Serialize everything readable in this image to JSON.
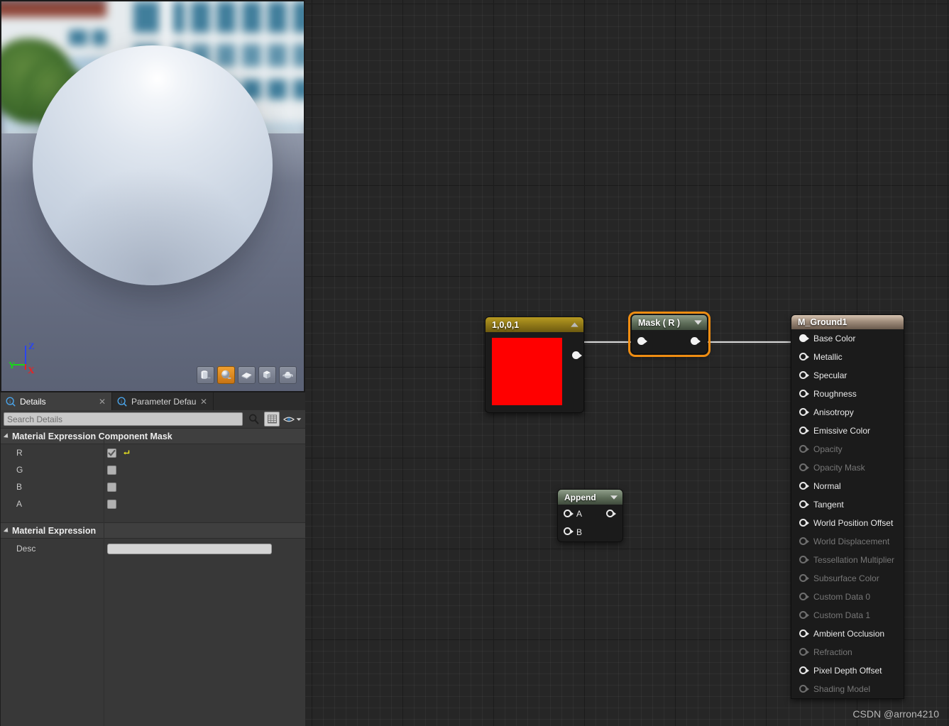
{
  "viewport": {
    "name": "material-preview-viewport",
    "gizmo": {
      "z": "Z",
      "y": "Y",
      "x": "X",
      "z_color": "#2b45ee",
      "y_color": "#19d619",
      "x_color": "#ee2020"
    },
    "shape_buttons": [
      {
        "name": "cylinder-shape-button",
        "icon": "cylinder-icon",
        "active": false
      },
      {
        "name": "sphere-shape-button",
        "icon": "sphere-icon",
        "active": true
      },
      {
        "name": "plane-shape-button",
        "icon": "plane-icon",
        "active": false
      },
      {
        "name": "cube-shape-button",
        "icon": "cube-icon",
        "active": false
      },
      {
        "name": "teapot-shape-button",
        "icon": "teapot-icon",
        "active": false
      }
    ],
    "active_shape": "sphere",
    "active_color": "#e0951f"
  },
  "details_panel": {
    "tabs": [
      {
        "label": "Details",
        "active": true
      },
      {
        "label": "Parameter Defaults",
        "active": false
      }
    ],
    "search": {
      "placeholder": "Search Details",
      "value": ""
    },
    "toolbar": {
      "grid_view_label": "Column View",
      "view_options_label": "View Options"
    },
    "sections": [
      {
        "title": "Material Expression Component Mask",
        "rows": [
          {
            "name": "R",
            "checked": true,
            "has_reset": true
          },
          {
            "name": "G",
            "checked": false,
            "has_reset": false
          },
          {
            "name": "B",
            "checked": false,
            "has_reset": false
          },
          {
            "name": "A",
            "checked": false,
            "has_reset": false
          }
        ]
      },
      {
        "title": "Material Expression",
        "text_rows": [
          {
            "name": "Desc",
            "value": "",
            "placeholder": ""
          }
        ]
      }
    ]
  },
  "graph": {
    "nodes": {
      "constant": {
        "title": "1,0,0,1",
        "collapse_icon": "chevron-up-icon",
        "swatch_color": "#ff0000",
        "output_pin": "output-pin"
      },
      "mask": {
        "title": "Mask ( R )",
        "collapse_icon": "chevron-down-icon",
        "selected": true,
        "selection_color": "#ef8d12",
        "input_pin": "input-pin",
        "output_pin": "output-pin"
      },
      "append": {
        "title": "Append",
        "collapse_icon": "chevron-down-icon",
        "inputs": [
          "A",
          "B"
        ],
        "output_pin": "output-pin"
      },
      "material": {
        "title": "M_Ground1",
        "pins": [
          {
            "label": "Base Color",
            "enabled": true,
            "connected": true
          },
          {
            "label": "Metallic",
            "enabled": true,
            "connected": false
          },
          {
            "label": "Specular",
            "enabled": true,
            "connected": false
          },
          {
            "label": "Roughness",
            "enabled": true,
            "connected": false
          },
          {
            "label": "Anisotropy",
            "enabled": true,
            "connected": false
          },
          {
            "label": "Emissive Color",
            "enabled": true,
            "connected": false
          },
          {
            "label": "Opacity",
            "enabled": false,
            "connected": false
          },
          {
            "label": "Opacity Mask",
            "enabled": false,
            "connected": false
          },
          {
            "label": "Normal",
            "enabled": true,
            "connected": false
          },
          {
            "label": "Tangent",
            "enabled": true,
            "connected": false
          },
          {
            "label": "World Position Offset",
            "enabled": true,
            "connected": false
          },
          {
            "label": "World Displacement",
            "enabled": false,
            "connected": false
          },
          {
            "label": "Tessellation Multiplier",
            "enabled": false,
            "connected": false
          },
          {
            "label": "Subsurface Color",
            "enabled": false,
            "connected": false
          },
          {
            "label": "Custom Data 0",
            "enabled": false,
            "connected": false
          },
          {
            "label": "Custom Data 1",
            "enabled": false,
            "connected": false
          },
          {
            "label": "Ambient Occlusion",
            "enabled": true,
            "connected": false
          },
          {
            "label": "Refraction",
            "enabled": false,
            "connected": false
          },
          {
            "label": "Pixel Depth Offset",
            "enabled": true,
            "connected": false
          },
          {
            "label": "Shading Model",
            "enabled": false,
            "connected": false
          }
        ]
      }
    }
  },
  "watermark": "CSDN @arron4210"
}
